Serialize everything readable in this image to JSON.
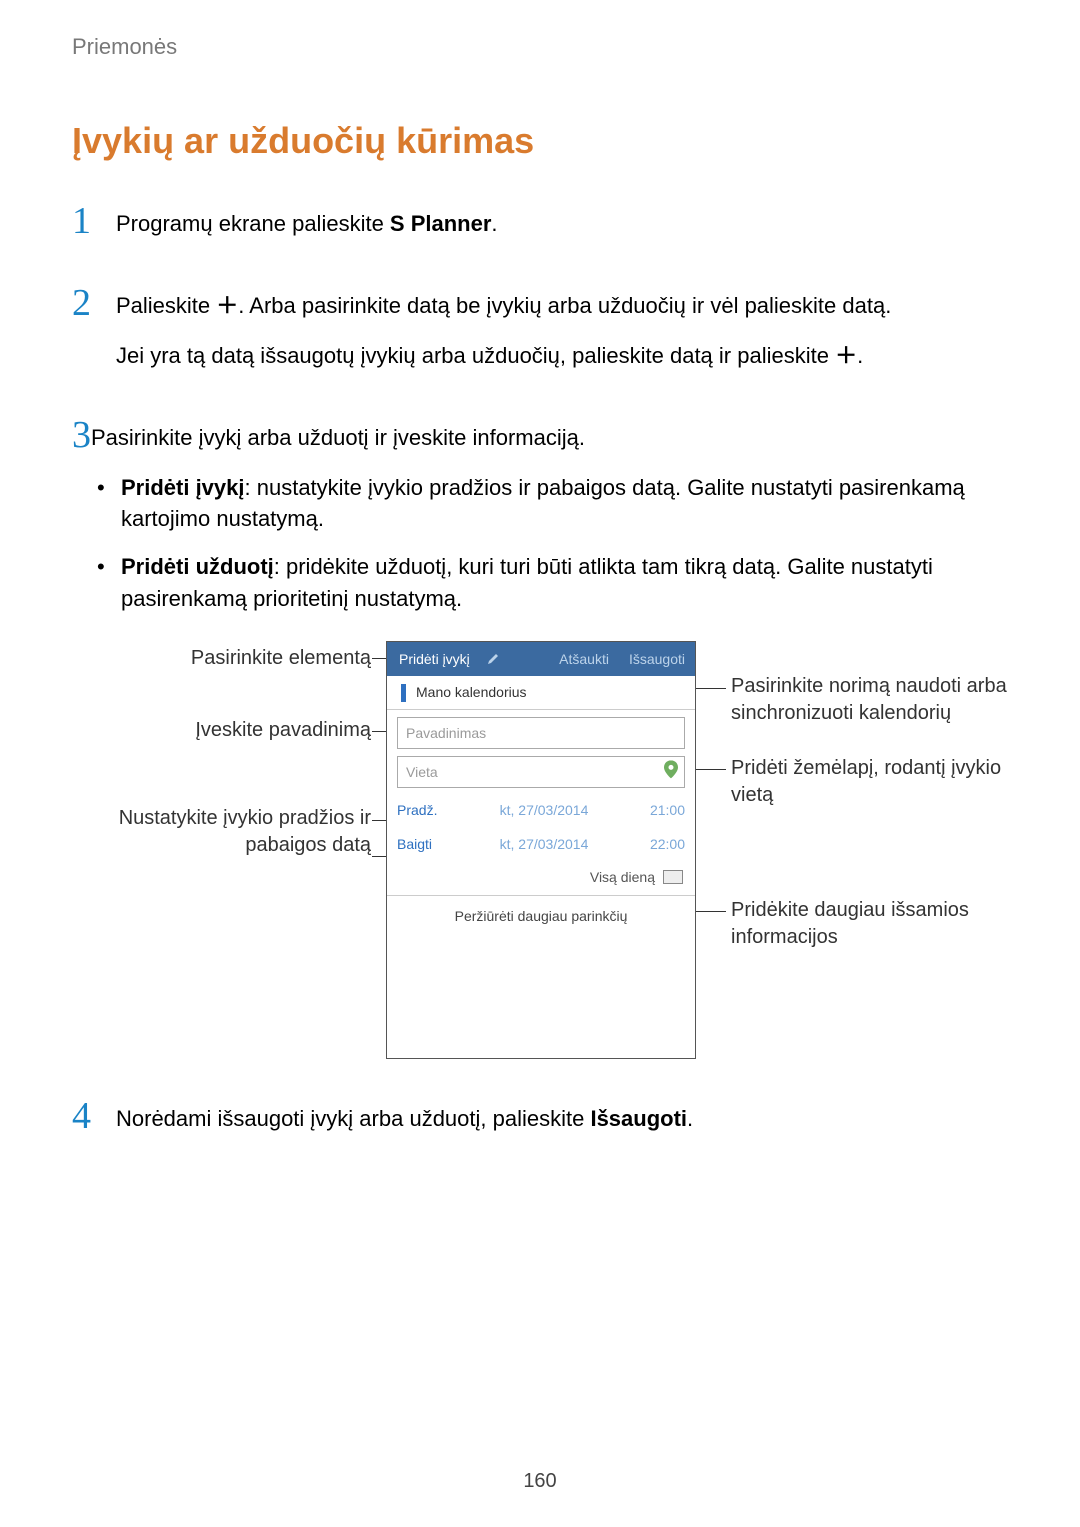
{
  "breadcrumb": "Priemonės",
  "title": "Įvykių ar užduočių kūrimas",
  "steps": {
    "s1": {
      "num": "1",
      "text_a": "Programų ekrane palieskite ",
      "text_b": "S Planner",
      "text_c": "."
    },
    "s2": {
      "num": "2",
      "line1_a": "Palieskite ",
      "line1_b": ". Arba pasirinkite datą be įvykių arba užduočių ir vėl palieskite datą.",
      "line2_a": "Jei yra tą datą išsaugotų įvykių arba užduočių, palieskite datą ir palieskite ",
      "line2_b": "."
    },
    "s3": {
      "num": "3",
      "intro": "Pasirinkite įvykį arba užduotį ir įveskite informaciją.",
      "b1_bold": "Pridėti įvykį",
      "b1_rest": ": nustatykite įvykio pradžios ir pabaigos datą. Galite nustatyti pasirenkamą kartojimo nustatymą.",
      "b2_bold": "Pridėti užduotį",
      "b2_rest": ": pridėkite užduotį, kuri turi būti atlikta tam tikrą datą. Galite nustatyti pasirenkamą prioritetinį nustatymą."
    },
    "s4": {
      "num": "4",
      "text_a": "Norėdami išsaugoti įvykį arba užduotį, palieskite ",
      "text_b": "Išsaugoti",
      "text_c": "."
    }
  },
  "screenshot": {
    "tab_add": "Pridėti įvykį",
    "tab_cancel": "Atšaukti",
    "tab_save": "Išsaugoti",
    "calendar": "Mano kalendorius",
    "name_ph": "Pavadinimas",
    "place_ph": "Vieta",
    "start_lbl": "Pradž.",
    "start_date": "kt, 27/03/2014",
    "start_time": "21:00",
    "end_lbl": "Baigti",
    "end_date": "kt, 27/03/2014",
    "end_time": "22:00",
    "allday": "Visą dieną",
    "more": "Peržiūrėti daugiau parinkčių"
  },
  "callouts": {
    "left1": "Pasirinkite elementą",
    "left2": "Įveskite pavadinimą",
    "left3": "Nustatykite įvykio pradžios ir pabaigos datą",
    "right1": "Pasirinkite norimą naudoti arba sinchronizuoti kalendorių",
    "right2": "Pridėti žemėlapį, rodantį įvykio vietą",
    "right3": "Pridėkite daugiau išsamios informacijos"
  },
  "pageNumber": "160"
}
